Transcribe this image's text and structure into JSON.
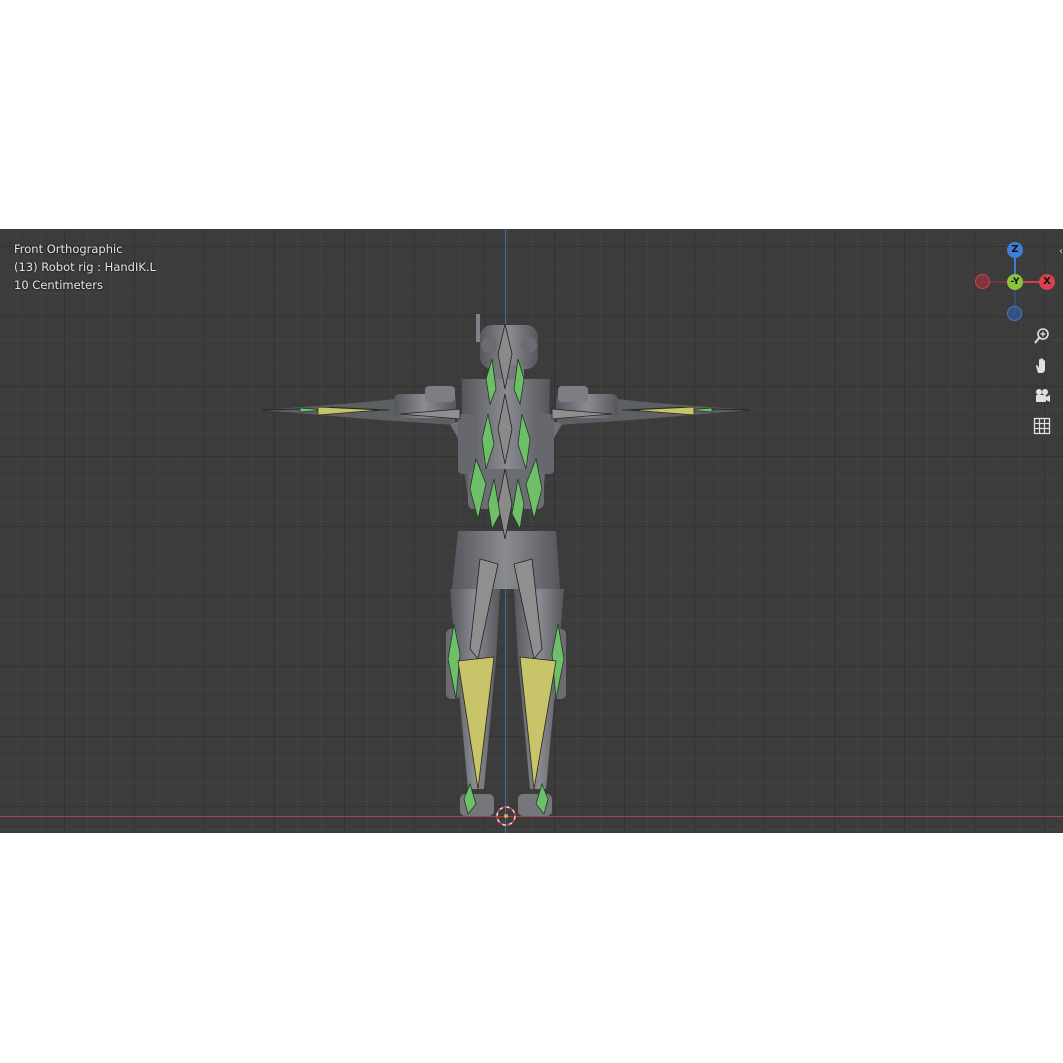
{
  "viewport": {
    "view_name": "Front Orthographic",
    "object_info": "(13) Robot rig : HandIK.L",
    "scale_info": "10 Centimeters"
  },
  "gizmo": {
    "z_label": "Z",
    "y_label": "-Y",
    "x_label": "X",
    "colors": {
      "z": "#3b7fd6",
      "y": "#8ac43a",
      "x": "#d6404f",
      "neg": "#a8323e",
      "negz": "#2f5fa8"
    }
  },
  "nav_icons": [
    "zoom-icon",
    "hand-pan-icon",
    "camera-icon",
    "grid-icon"
  ],
  "colors": {
    "background": "#3c3c3c",
    "grid_major": "#333333",
    "x_axis": "#a6444c",
    "z_axis": "#3f6cb4",
    "bone_selected": "#c7c46a",
    "bone_green": "#6fbf6a",
    "bone_gray": "#8a8a8a",
    "mesh": "#6e7075"
  }
}
